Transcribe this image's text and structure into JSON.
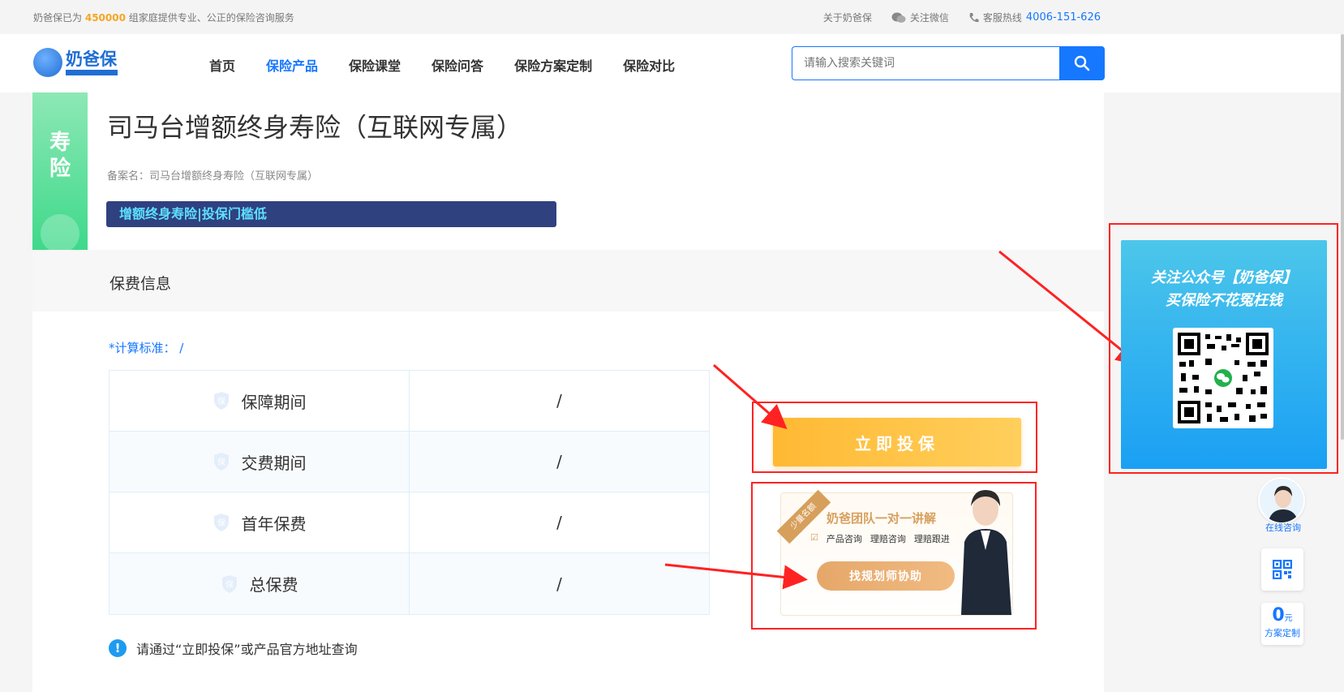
{
  "topbar": {
    "intro_prefix": "奶爸保已为",
    "intro_count": "450000",
    "intro_suffix": "组家庭提供专业、公正的保险咨询服务",
    "about": "关于奶爸保",
    "wechat": "关注微信",
    "hotline_label": "客服热线",
    "hotline_number": "4006-151-626"
  },
  "header": {
    "logo_text": "奶爸保",
    "nav": [
      "首页",
      "保险产品",
      "保险课堂",
      "保险问答",
      "保险方案定制",
      "保险对比"
    ],
    "active_nav": "保险产品",
    "search_placeholder": "请输入搜索关键词"
  },
  "product": {
    "category_badge": "寿险",
    "title": "司马台增额终身寿险（互联网专属）",
    "registered_name": "备案名：司马台增额终身寿险（互联网专属）",
    "tag": "增额终身寿险|投保门槛低"
  },
  "premium": {
    "section_title": "保费信息",
    "calc_standard": "*计算标准： /",
    "rows": [
      {
        "label": "保障期间",
        "value": "/"
      },
      {
        "label": "交费期间",
        "value": "/"
      },
      {
        "label": "首年保费",
        "value": "/"
      },
      {
        "label": "总保费",
        "value": "/"
      }
    ],
    "note": "请通过“立即投保”或产品官方地址查询"
  },
  "actions": {
    "buy_button": "立即投保",
    "advisor_ribbon": "少量名额",
    "advisor_title": "奶爸团队一对一讲解",
    "advisor_tags": [
      "产品咨询",
      "理赔咨询",
      "理赔跟进"
    ],
    "advisor_cta": "找规划师协助"
  },
  "qr_panel": {
    "line1": "关注公众号【奶爸保】",
    "line2": "买保险不花冤枉钱"
  },
  "side_tools": {
    "consult_label": "在线咨询",
    "plan_price": "0",
    "plan_unit": "元",
    "plan_label": "方案定制"
  },
  "colors": {
    "brand_blue": "#1677ff",
    "highlight_orange": "#f5a623",
    "badge_green": "#3ed98a",
    "tag_navy": "#304180",
    "buy_yellow": "#ffb933",
    "annotation_red": "#ff2222"
  }
}
